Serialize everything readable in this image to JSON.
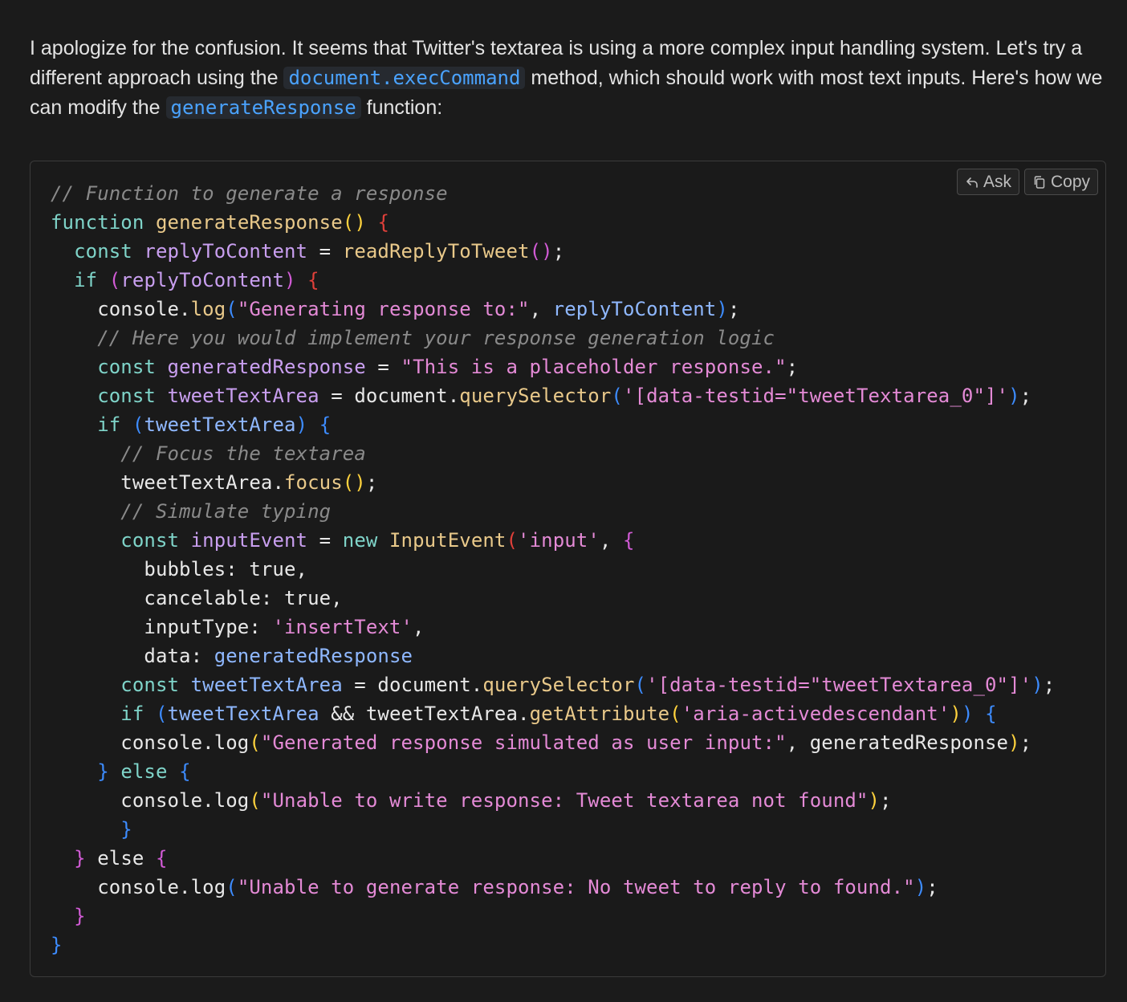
{
  "intro": {
    "t1": "I apologize for the confusion. It seems that Twitter's textarea is using a more complex input handling system. Let's try a different approach using the ",
    "c1": "document.execCommand",
    "t2": " method, which should work with most text inputs. Here's how we can modify the ",
    "c2": "generateResponse",
    "t3": " function:"
  },
  "toolbar": {
    "ask_label": "Ask",
    "copy_label": "Copy"
  },
  "code": {
    "language": "javascript",
    "tokens": {
      "cm1": "// Function to generate a response",
      "fname": "generateResponse",
      "replyToContent": "replyToContent",
      "readReply": "readReplyToTweet",
      "consoleDot": "console.",
      "log": "log",
      "str_generating": "\"Generating response to:\"",
      "cm2": "// Here you would implement your response generation logic",
      "generatedResponse": "generatedResponse",
      "str_placeholder": "\"This is a placeholder response.\"",
      "tweetTextArea": "tweetTextArea",
      "documentDot": "document.",
      "querySelector": "querySelector",
      "str_selector": "'[data-testid=\"tweetTextarea_0\"]'",
      "cm3": "// Focus the textarea",
      "focus": "focus",
      "cm4": "// Simulate typing",
      "InputEvent": "InputEvent",
      "str_input": "'input'",
      "str_insertText": "'insertText'",
      "getAttribute": "getAttribute",
      "str_aria": "'aria-activedescendant'",
      "str_generated": "\"Generated response simulated as user input:\"",
      "str_unable_write": "\"Unable to write response: Tweet textarea not found\"",
      "str_unable_generate": "\"Unable to generate response: No tweet to reply to found.\""
    }
  },
  "colors": {
    "background": "#1b1b1b",
    "inline_code": "#4aa3ff",
    "comment": "#8a8a8a",
    "keyword": "#7fd4c9",
    "function": "#e9c98a",
    "variable": "#c99ff0",
    "string": "#e48ad6"
  },
  "icons": {
    "ask": "reply-arrow-icon",
    "copy": "copy-icon"
  }
}
